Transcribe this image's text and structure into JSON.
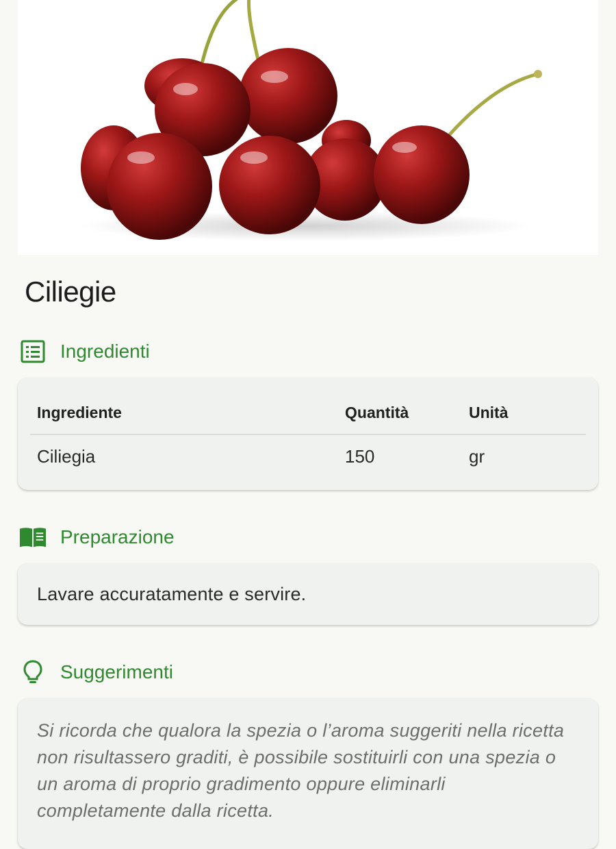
{
  "recipe": {
    "title": "Ciliegie",
    "image_alt": "cherries-photo"
  },
  "ingredients": {
    "heading": "Ingredienti",
    "columns": [
      "Ingrediente",
      "Quantità",
      "Unità"
    ],
    "rows": [
      {
        "name": "Ciliegia",
        "quantity": "150",
        "unit": "gr"
      }
    ]
  },
  "preparation": {
    "heading": "Preparazione",
    "text": "Lavare accuratamente e servire."
  },
  "tips": {
    "heading": "Suggerimenti",
    "text": "Si ricorda che qualora la spezia o l’aroma suggeriti nella ricetta non risultassero graditi, è possibile sostituirli con una spezia o un aroma di proprio gradimento oppure eliminarli completamente dalla ricetta."
  },
  "colors": {
    "accent": "#2f8a2f",
    "card_bg": "#eff2ee",
    "page_bg": "#f8f8f4"
  }
}
